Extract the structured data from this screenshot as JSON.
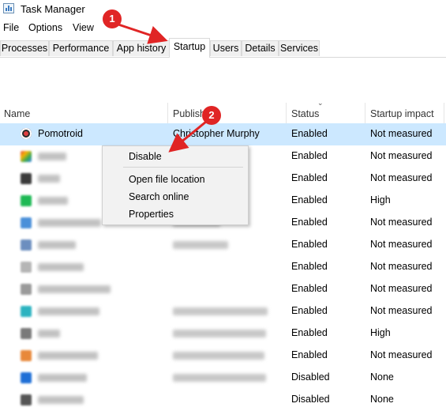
{
  "window": {
    "title": "Task Manager"
  },
  "menu": [
    "File",
    "Options",
    "View"
  ],
  "tabs": [
    "Processes",
    "Performance",
    "App history",
    "Startup",
    "Users",
    "Details",
    "Services"
  ],
  "active_tab": "Startup",
  "columns": {
    "name": "Name",
    "publisher": "Publish",
    "status": "Status",
    "impact": "Startup impact"
  },
  "rows": [
    {
      "name": "Pomotroid",
      "publisher": "Christopher Murphy",
      "status": "Enabled",
      "impact": "Not measured"
    },
    {
      "name": "",
      "publisher": "",
      "status": "Enabled",
      "impact": "Not measured"
    },
    {
      "name": "",
      "publisher": "",
      "status": "Enabled",
      "impact": "Not measured"
    },
    {
      "name": "",
      "publisher": "",
      "status": "Enabled",
      "impact": "High"
    },
    {
      "name": "",
      "publisher": "",
      "status": "Enabled",
      "impact": "Not measured"
    },
    {
      "name": "",
      "publisher": "",
      "status": "Enabled",
      "impact": "Not measured"
    },
    {
      "name": "",
      "publisher": "",
      "status": "Enabled",
      "impact": "Not measured"
    },
    {
      "name": "",
      "publisher": "",
      "status": "Enabled",
      "impact": "Not measured"
    },
    {
      "name": "",
      "publisher": "",
      "status": "Enabled",
      "impact": "Not measured"
    },
    {
      "name": "",
      "publisher": "",
      "status": "Enabled",
      "impact": "High"
    },
    {
      "name": "",
      "publisher": "",
      "status": "Enabled",
      "impact": "Not measured"
    },
    {
      "name": "",
      "publisher": "",
      "status": "Disabled",
      "impact": "None"
    },
    {
      "name": "",
      "publisher": "",
      "status": "Disabled",
      "impact": "None"
    }
  ],
  "context_menu": {
    "items": [
      "Disable",
      "Open file location",
      "Search online",
      "Properties"
    ]
  },
  "callouts": [
    "1",
    "2"
  ],
  "colors": {
    "selection": "#cce8ff",
    "callout": "#e02525"
  }
}
